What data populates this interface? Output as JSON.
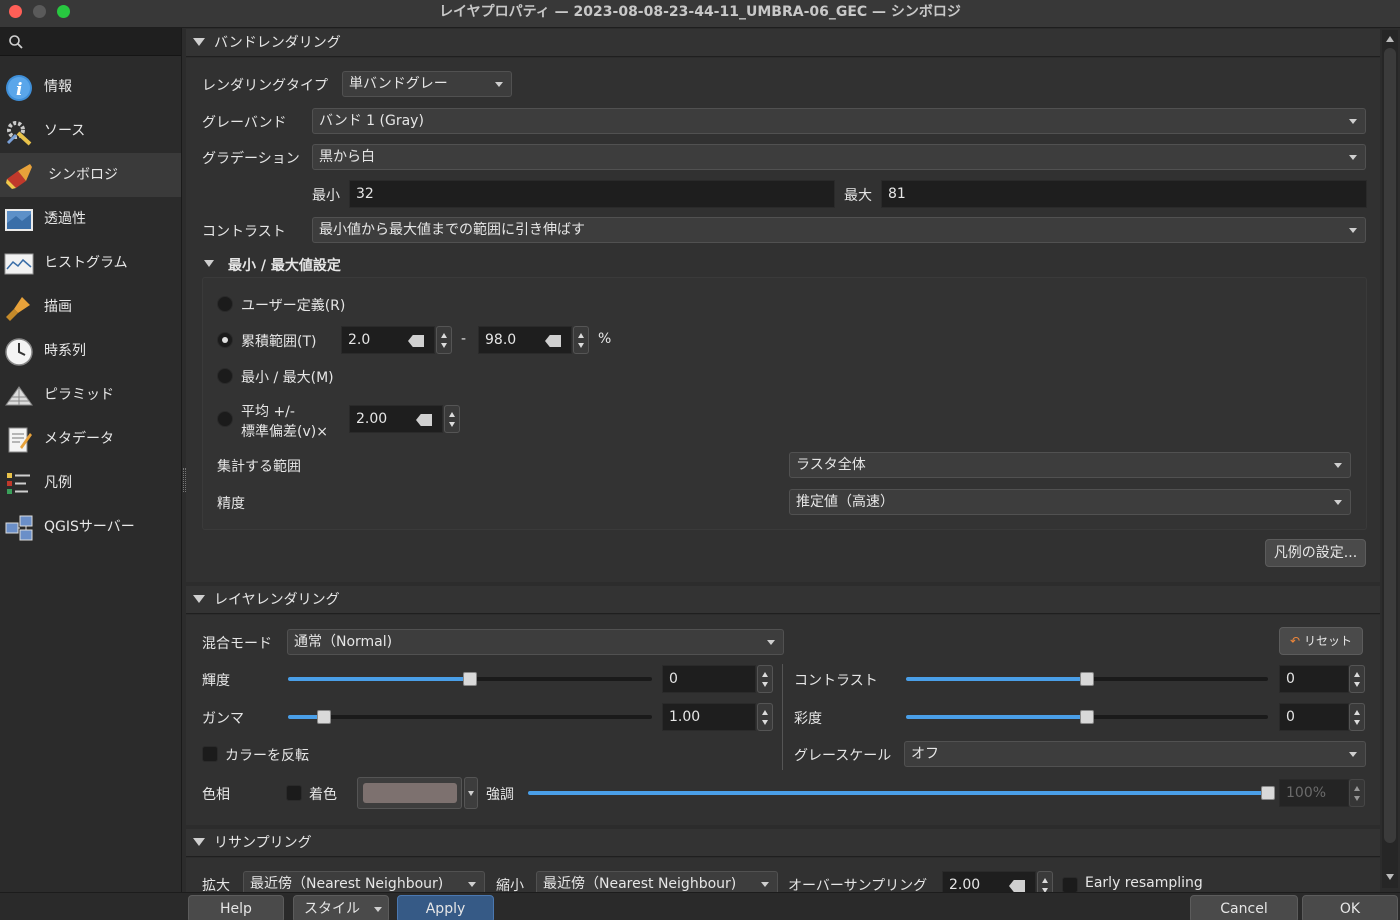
{
  "window": {
    "title": "レイヤプロパティ — 2023-08-08-23-44-11_UMBRA-06_GEC — シンボロジ",
    "traffic_colors": [
      "#ff5f57",
      "#5a5a5a",
      "#28c840"
    ]
  },
  "sidebar": {
    "items": [
      {
        "label": "情報",
        "icon": "info-icon"
      },
      {
        "label": "ソース",
        "icon": "source-icon"
      },
      {
        "label": "シンボロジ",
        "icon": "symbology-icon",
        "selected": true
      },
      {
        "label": "透過性",
        "icon": "transparency-icon"
      },
      {
        "label": "ヒストグラム",
        "icon": "histogram-icon"
      },
      {
        "label": "描画",
        "icon": "rendering-icon"
      },
      {
        "label": "時系列",
        "icon": "clock-icon"
      },
      {
        "label": "ピラミッド",
        "icon": "pyramid-icon"
      },
      {
        "label": "メタデータ",
        "icon": "metadata-icon"
      },
      {
        "label": "凡例",
        "icon": "legend-icon"
      },
      {
        "label": "QGISサーバー",
        "icon": "server-icon"
      }
    ]
  },
  "band_rendering": {
    "header": "バンドレンダリング",
    "render_type_label": "レンダリングタイプ",
    "render_type_value": "単バンドグレー",
    "gray_band_label": "グレーバンド",
    "gray_band_value": "バンド 1 (Gray)",
    "gradient_label": "グラデーション",
    "gradient_value": "黒から白",
    "min_label": "最小",
    "min_value": "32",
    "max_label": "最大",
    "max_value": "81",
    "contrast_label": "コントラスト",
    "contrast_value": "最小値から最大値までの範囲に引き伸ばす",
    "minmax_header": "最小 / 最大値設定",
    "radio_user": "ユーザー定義(R)",
    "radio_cumulative": "累積範囲(T)",
    "cum_low": "2.0",
    "cum_dash": "-",
    "cum_high": "98.0",
    "cum_pct": "%",
    "radio_minmax": "最小 / 最大(M)",
    "radio_mean_line1": "平均 +/-",
    "radio_mean_line2": "標準偏差(v)×",
    "stddev_value": "2.00",
    "extent_label": "集計する範囲",
    "extent_value": "ラスタ全体",
    "accuracy_label": "精度",
    "accuracy_value": "推定値（高速）",
    "legend_button": "凡例の設定..."
  },
  "layer_rendering": {
    "header": "レイヤレンダリング",
    "blend_label": "混合モード",
    "blend_value": "通常（Normal)",
    "reset_button": "リセット",
    "brightness_label": "輝度",
    "brightness_value": "0",
    "brightness_level": 0.5,
    "contrast_label": "コントラスト",
    "contrast_value": "0",
    "contrast_level": 0.5,
    "gamma_label": "ガンマ",
    "gamma_value": "1.00",
    "gamma_level": 0.1,
    "saturation_label": "彩度",
    "saturation_value": "0",
    "saturation_level": 0.5,
    "invert_label": "カラーを反転",
    "grayscale_label": "グレースケール",
    "grayscale_value": "オフ",
    "hue_label": "色相",
    "colorize_label": "着色",
    "colorize_color": "#7d716f",
    "strength_label": "強調",
    "strength_value": "100%",
    "strength_level": 1.0
  },
  "resampling": {
    "header": "リサンプリング",
    "zoomin_label": "拡大",
    "zoomin_value": "最近傍（Nearest Neighbour)",
    "zoomout_label": "縮小",
    "zoomout_value": "最近傍（Nearest Neighbour)",
    "oversampling_label": "オーバーサンプリング",
    "oversampling_value": "2.00",
    "early_label": "Early resampling"
  },
  "bottom": {
    "help": "Help",
    "style": "スタイル",
    "apply": "Apply",
    "cancel": "Cancel",
    "ok": "OK"
  }
}
